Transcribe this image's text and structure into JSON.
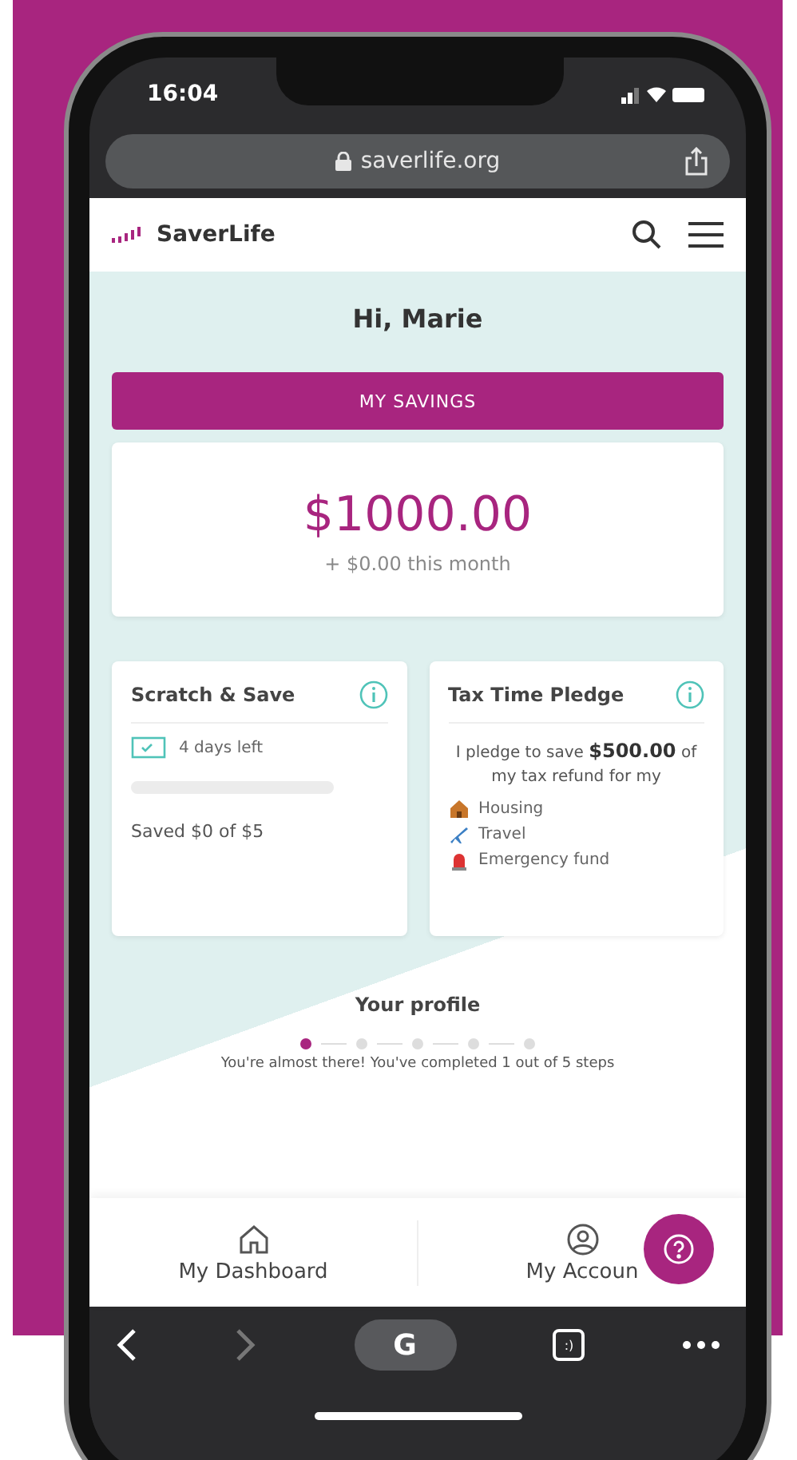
{
  "status_bar": {
    "time": "16:04"
  },
  "browser": {
    "url": "saverlife.org",
    "toolbar_letter": "G",
    "tabs_label": ":)"
  },
  "header": {
    "logo": "SaverLife"
  },
  "greeting": "Hi, Marie",
  "savings": {
    "button": "MY SAVINGS",
    "amount": "$1000.00",
    "monthly": "+ $0.00 this month"
  },
  "scratch_card": {
    "title": "Scratch & Save",
    "days_left": "4 days left",
    "level": 0,
    "saved": "Saved $0 of $5"
  },
  "pledge_card": {
    "title": "Tax Time Pledge",
    "text": "I pledge to save **$500.00** of my tax refund for my",
    "items": [
      {
        "kind": "housing",
        "label": "Housing"
      },
      {
        "kind": "travel",
        "label": "Travel"
      },
      {
        "kind": "emergency",
        "label": "Emergency fund"
      }
    ]
  },
  "profile": {
    "title": "Your profile",
    "steps": [
      {
        "selected": true
      },
      {
        "selected": false
      },
      {
        "selected": false
      },
      {
        "selected": false
      },
      {
        "selected": false
      }
    ],
    "message": "You're almost there! You've completed 1 out of 5 steps"
  },
  "nav": [
    {
      "kind": "home",
      "label": "My Dashboard"
    },
    {
      "kind": "account",
      "label": "My Accoun"
    }
  ]
}
